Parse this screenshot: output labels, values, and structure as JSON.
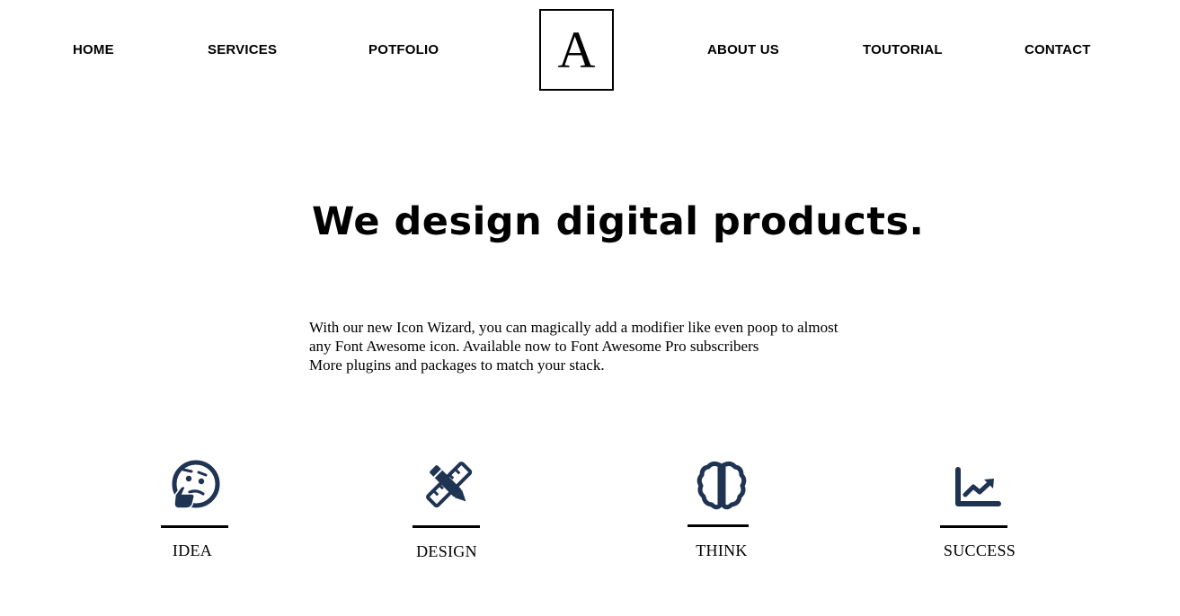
{
  "nav": {
    "left": [
      "HOME",
      "SERVICES",
      "POTFOLIO"
    ],
    "right": [
      "ABOUT US",
      "TOUTORIAL",
      "CONTACT"
    ],
    "logo_letter": "A"
  },
  "hero": {
    "headline": "We design digital products.",
    "paragraph": [
      "With our new Icon Wizard, you can magically add a modifier like even poop to almost",
      "any Font Awesome icon. Available now to Font Awesome Pro subscribers",
      "More plugins and packages to match your stack."
    ]
  },
  "features": [
    {
      "label": "IDEA",
      "icon": "thinking-face-icon"
    },
    {
      "label": "DESIGN",
      "icon": "pencil-ruler-icon"
    },
    {
      "label": "THINK",
      "icon": "brain-icon"
    },
    {
      "label": "SUCCESS",
      "icon": "chart-line-icon"
    }
  ],
  "colors": {
    "icon": "#1f3352",
    "text": "#000000",
    "background": "#ffffff"
  }
}
